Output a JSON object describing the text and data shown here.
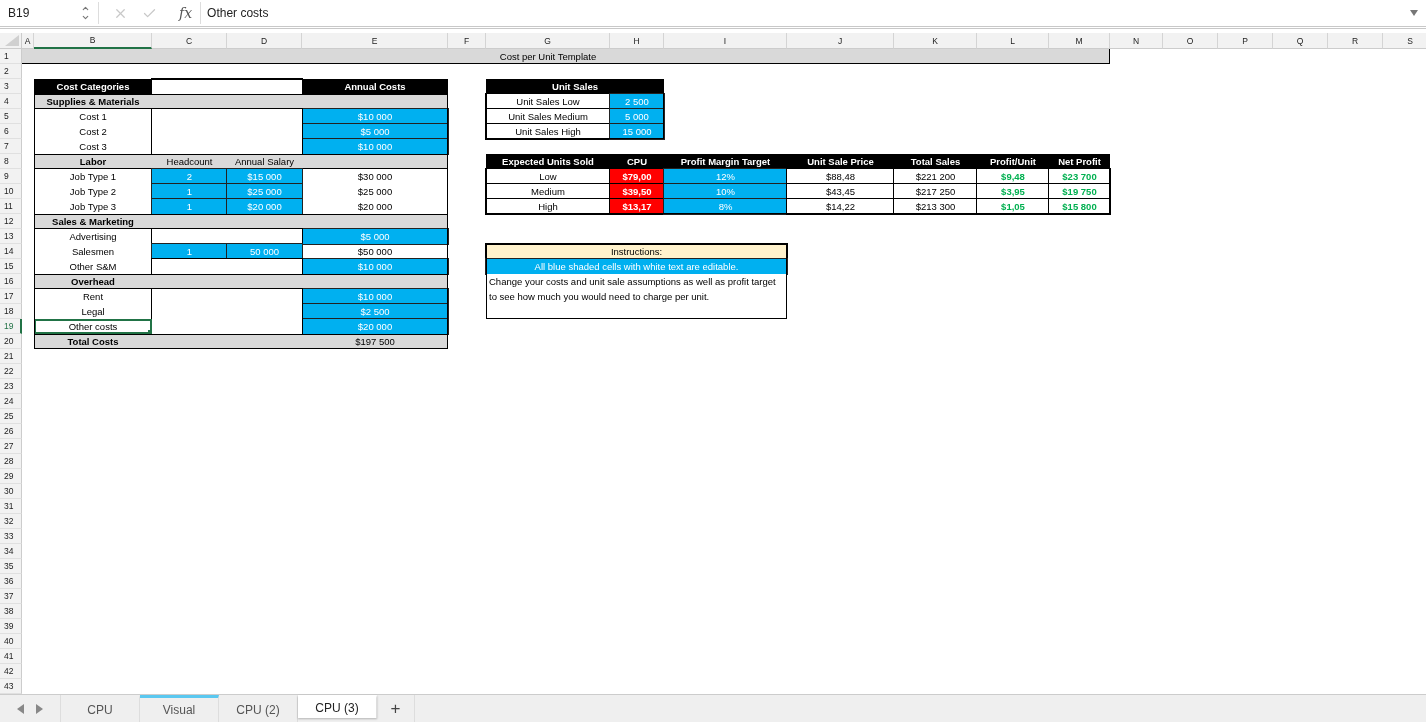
{
  "formula_bar": {
    "name_box": "B19",
    "function_label": "fx",
    "formula": "Other costs"
  },
  "sheet": {
    "columns": [
      {
        "label": "A",
        "selected": false
      },
      {
        "label": "B",
        "selected": true
      },
      {
        "label": "C",
        "selected": false
      },
      {
        "label": "D",
        "selected": false
      },
      {
        "label": "E",
        "selected": false
      },
      {
        "label": "F",
        "selected": false
      },
      {
        "label": "G",
        "selected": false
      },
      {
        "label": "H",
        "selected": false
      },
      {
        "label": "I",
        "selected": false
      },
      {
        "label": "J",
        "selected": false
      },
      {
        "label": "K",
        "selected": false
      },
      {
        "label": "L",
        "selected": false
      },
      {
        "label": "M",
        "selected": false
      },
      {
        "label": "N",
        "selected": false
      },
      {
        "label": "O",
        "selected": false
      },
      {
        "label": "P",
        "selected": false
      },
      {
        "label": "Q",
        "selected": false
      },
      {
        "label": "R",
        "selected": false
      },
      {
        "label": "S",
        "selected": false
      }
    ],
    "rows": [
      {
        "label": "1",
        "selected": false
      },
      {
        "label": "2",
        "selected": false
      },
      {
        "label": "3",
        "selected": false
      },
      {
        "label": "4",
        "selected": false
      },
      {
        "label": "5",
        "selected": false
      },
      {
        "label": "6",
        "selected": false
      },
      {
        "label": "7",
        "selected": false
      },
      {
        "label": "8",
        "selected": false
      },
      {
        "label": "9",
        "selected": false
      },
      {
        "label": "10",
        "selected": false
      },
      {
        "label": "11",
        "selected": false
      },
      {
        "label": "12",
        "selected": false
      },
      {
        "label": "13",
        "selected": false
      },
      {
        "label": "14",
        "selected": false
      },
      {
        "label": "15",
        "selected": false
      },
      {
        "label": "16",
        "selected": false
      },
      {
        "label": "17",
        "selected": false
      },
      {
        "label": "18",
        "selected": false
      },
      {
        "label": "19",
        "selected": true
      },
      {
        "label": "20",
        "selected": false
      },
      {
        "label": "21",
        "selected": false
      },
      {
        "label": "22",
        "selected": false
      },
      {
        "label": "23",
        "selected": false
      },
      {
        "label": "24",
        "selected": false
      },
      {
        "label": "25",
        "selected": false
      },
      {
        "label": "26",
        "selected": false
      },
      {
        "label": "27",
        "selected": false
      },
      {
        "label": "28",
        "selected": false
      },
      {
        "label": "29",
        "selected": false
      },
      {
        "label": "30",
        "selected": false
      },
      {
        "label": "31",
        "selected": false
      },
      {
        "label": "32",
        "selected": false
      },
      {
        "label": "33",
        "selected": false
      },
      {
        "label": "34",
        "selected": false
      },
      {
        "label": "35",
        "selected": false
      },
      {
        "label": "36",
        "selected": false
      },
      {
        "label": "37",
        "selected": false
      },
      {
        "label": "38",
        "selected": false
      },
      {
        "label": "39",
        "selected": false
      },
      {
        "label": "40",
        "selected": false
      },
      {
        "label": "41",
        "selected": false
      },
      {
        "label": "42",
        "selected": false
      },
      {
        "label": "43",
        "selected": false
      }
    ],
    "title": "Cost per Unit Template",
    "cost_table": {
      "headers": [
        "Cost Categories",
        "Annual Costs"
      ],
      "sections": [
        {
          "name": "Supplies & Materials",
          "items": [
            {
              "label": "Cost 1",
              "annual": {
                "text": "$10 000",
                "kind": "input"
              }
            },
            {
              "label": "Cost 2",
              "annual": {
                "text": "$5 000",
                "kind": "input"
              }
            },
            {
              "label": "Cost 3",
              "annual": {
                "text": "$10 000",
                "kind": "input"
              }
            }
          ]
        },
        {
          "name": "Labor",
          "columns": [
            "Headcount",
            "Annual Salary"
          ],
          "items": [
            {
              "label": "Job Type 1",
              "headcount": {
                "text": "2",
                "kind": "input"
              },
              "salary": {
                "text": "$15 000",
                "kind": "input"
              },
              "annual": {
                "text": "$30 000",
                "kind": "value"
              }
            },
            {
              "label": "Job Type 2",
              "headcount": {
                "text": "1",
                "kind": "input"
              },
              "salary": {
                "text": "$25 000",
                "kind": "input"
              },
              "annual": {
                "text": "$25 000",
                "kind": "value"
              }
            },
            {
              "label": "Job Type 3",
              "headcount": {
                "text": "1",
                "kind": "input"
              },
              "salary": {
                "text": "$20 000",
                "kind": "input"
              },
              "annual": {
                "text": "$20 000",
                "kind": "value"
              }
            }
          ]
        },
        {
          "name": "Sales & Marketing",
          "items": [
            {
              "label": "Advertising",
              "annual": {
                "text": "$5 000",
                "kind": "input"
              }
            },
            {
              "label": "Salesmen",
              "headcount": {
                "text": "1",
                "kind": "input"
              },
              "salary": {
                "text": "50 000",
                "kind": "input"
              },
              "annual": {
                "text": "$50 000",
                "kind": "value"
              }
            },
            {
              "label": "Other S&M",
              "annual": {
                "text": "$10 000",
                "kind": "input"
              }
            }
          ]
        },
        {
          "name": "Overhead",
          "items": [
            {
              "label": "Rent",
              "annual": {
                "text": "$10 000",
                "kind": "input"
              }
            },
            {
              "label": "Legal",
              "annual": {
                "text": "$2 500",
                "kind": "input"
              }
            },
            {
              "label": "Other costs",
              "annual": {
                "text": "$20 000",
                "kind": "input"
              }
            }
          ]
        }
      ],
      "total": {
        "label": "Total Costs",
        "value": "$197 500"
      }
    },
    "unit_sales": {
      "title": "Unit Sales",
      "rows": [
        {
          "label": "Unit Sales Low",
          "value": {
            "text": "2 500",
            "kind": "input"
          }
        },
        {
          "label": "Unit Sales Medium",
          "value": {
            "text": "5 000",
            "kind": "input"
          }
        },
        {
          "label": "Unit Sales High",
          "value": {
            "text": "15 000",
            "kind": "input"
          }
        }
      ]
    },
    "scenarios": {
      "columns": [
        "Expected Units Sold",
        "CPU",
        "Profit Margin Target",
        "Unit Sale Price",
        "Total Sales",
        "Profit/Unit",
        "Net Profit"
      ],
      "rows": [
        {
          "cells": [
            {
              "text": "Low",
              "kind": "label"
            },
            {
              "text": "$79,00",
              "kind": "alert"
            },
            {
              "text": "12%",
              "kind": "input"
            },
            {
              "text": "$88,48",
              "kind": "value"
            },
            {
              "text": "$221 200",
              "kind": "value"
            },
            {
              "text": "$9,48",
              "kind": "profit"
            },
            {
              "text": "$23 700",
              "kind": "profit"
            }
          ]
        },
        {
          "cells": [
            {
              "text": "Medium",
              "kind": "label"
            },
            {
              "text": "$39,50",
              "kind": "alert"
            },
            {
              "text": "10%",
              "kind": "input"
            },
            {
              "text": "$43,45",
              "kind": "value"
            },
            {
              "text": "$217 250",
              "kind": "value"
            },
            {
              "text": "$3,95",
              "kind": "profit"
            },
            {
              "text": "$19 750",
              "kind": "profit"
            }
          ]
        },
        {
          "cells": [
            {
              "text": "High",
              "kind": "label"
            },
            {
              "text": "$13,17",
              "kind": "alert"
            },
            {
              "text": "8%",
              "kind": "input"
            },
            {
              "text": "$14,22",
              "kind": "value"
            },
            {
              "text": "$213 300",
              "kind": "value"
            },
            {
              "text": "$1,05",
              "kind": "profit"
            },
            {
              "text": "$15 800",
              "kind": "profit"
            }
          ]
        }
      ]
    },
    "instructions": {
      "heading": "Instructions:",
      "highlight": "All blue shaded cells with white text are editable.",
      "body": "Change your costs and unit sale assumptions as well as profit target to see how much you would need to charge per unit."
    }
  },
  "sheet_tabs": [
    {
      "label": "CPU",
      "selected": false
    },
    {
      "label": "Visual",
      "selected": false,
      "color": "#5ac8f0"
    },
    {
      "label": "CPU (2)",
      "selected": false
    },
    {
      "label": "CPU (3)",
      "selected": true
    }
  ],
  "add_sheet": "+"
}
